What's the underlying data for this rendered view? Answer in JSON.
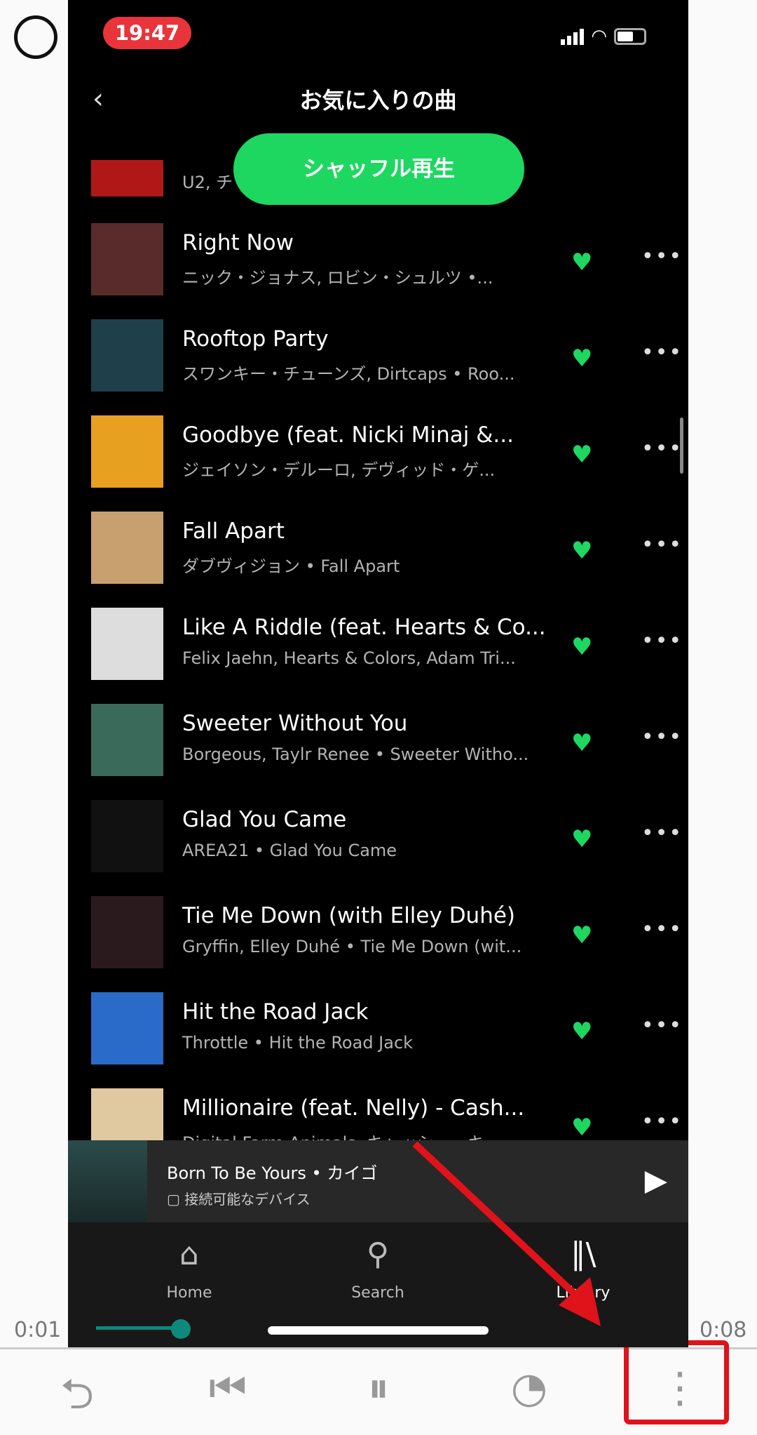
{
  "status": {
    "time": "19:47"
  },
  "header": {
    "title": "お気に入りの曲",
    "shuffle_label": "シャッフル再生"
  },
  "partial_row": {
    "subtitle": "U2, チ"
  },
  "tracks": [
    {
      "title": "Right Now",
      "subtitle": "ニック・ジョナス, ロビン・シュルツ •...",
      "color": "#5a2b2b"
    },
    {
      "title": "Rooftop Party",
      "subtitle": "スワンキー・チューンズ, Dirtcaps • Roo...",
      "color": "#1f3f4a"
    },
    {
      "title": "Goodbye (feat. Nicki Minaj &...",
      "subtitle": "ジェイソン・デルーロ, デヴィッド・ゲ...",
      "color": "#e8a020"
    },
    {
      "title": "Fall Apart",
      "subtitle": "ダブヴィジョン • Fall Apart",
      "color": "#c8a070"
    },
    {
      "title": "Like A Riddle (feat. Hearts & Co...",
      "subtitle": "Felix Jaehn, Hearts & Colors, Adam Tri...",
      "color": "#dddddd"
    },
    {
      "title": "Sweeter Without You",
      "subtitle": "Borgeous, Taylr Renee • Sweeter Witho...",
      "color": "#3a6a5a"
    },
    {
      "title": "Glad You Came",
      "subtitle": "AREA21 • Glad You Came",
      "color": "#111111"
    },
    {
      "title": "Tie Me Down (with Elley Duhé)",
      "subtitle": "Gryffin, Elley Duhé • Tie Me Down (wit...",
      "color": "#2a1a1e"
    },
    {
      "title": "Hit the Road Jack",
      "subtitle": "Throttle • Hit the Road Jack",
      "color": "#2a6ac8"
    },
    {
      "title": "Millionaire (feat. Nelly) - Cash...",
      "subtitle": "Digital Farm Animals, キャッシュ・キ...",
      "color": "#e0c8a0"
    }
  ],
  "mini_player": {
    "title": "Born To Be Yours • カイゴ",
    "device": "接続可能なデバイス"
  },
  "nav": {
    "home": "Home",
    "search": "Search",
    "library": "Library"
  },
  "video": {
    "elapsed": "0:01",
    "total": "0:08",
    "progress": 0.12
  },
  "accent": "#1ed760"
}
